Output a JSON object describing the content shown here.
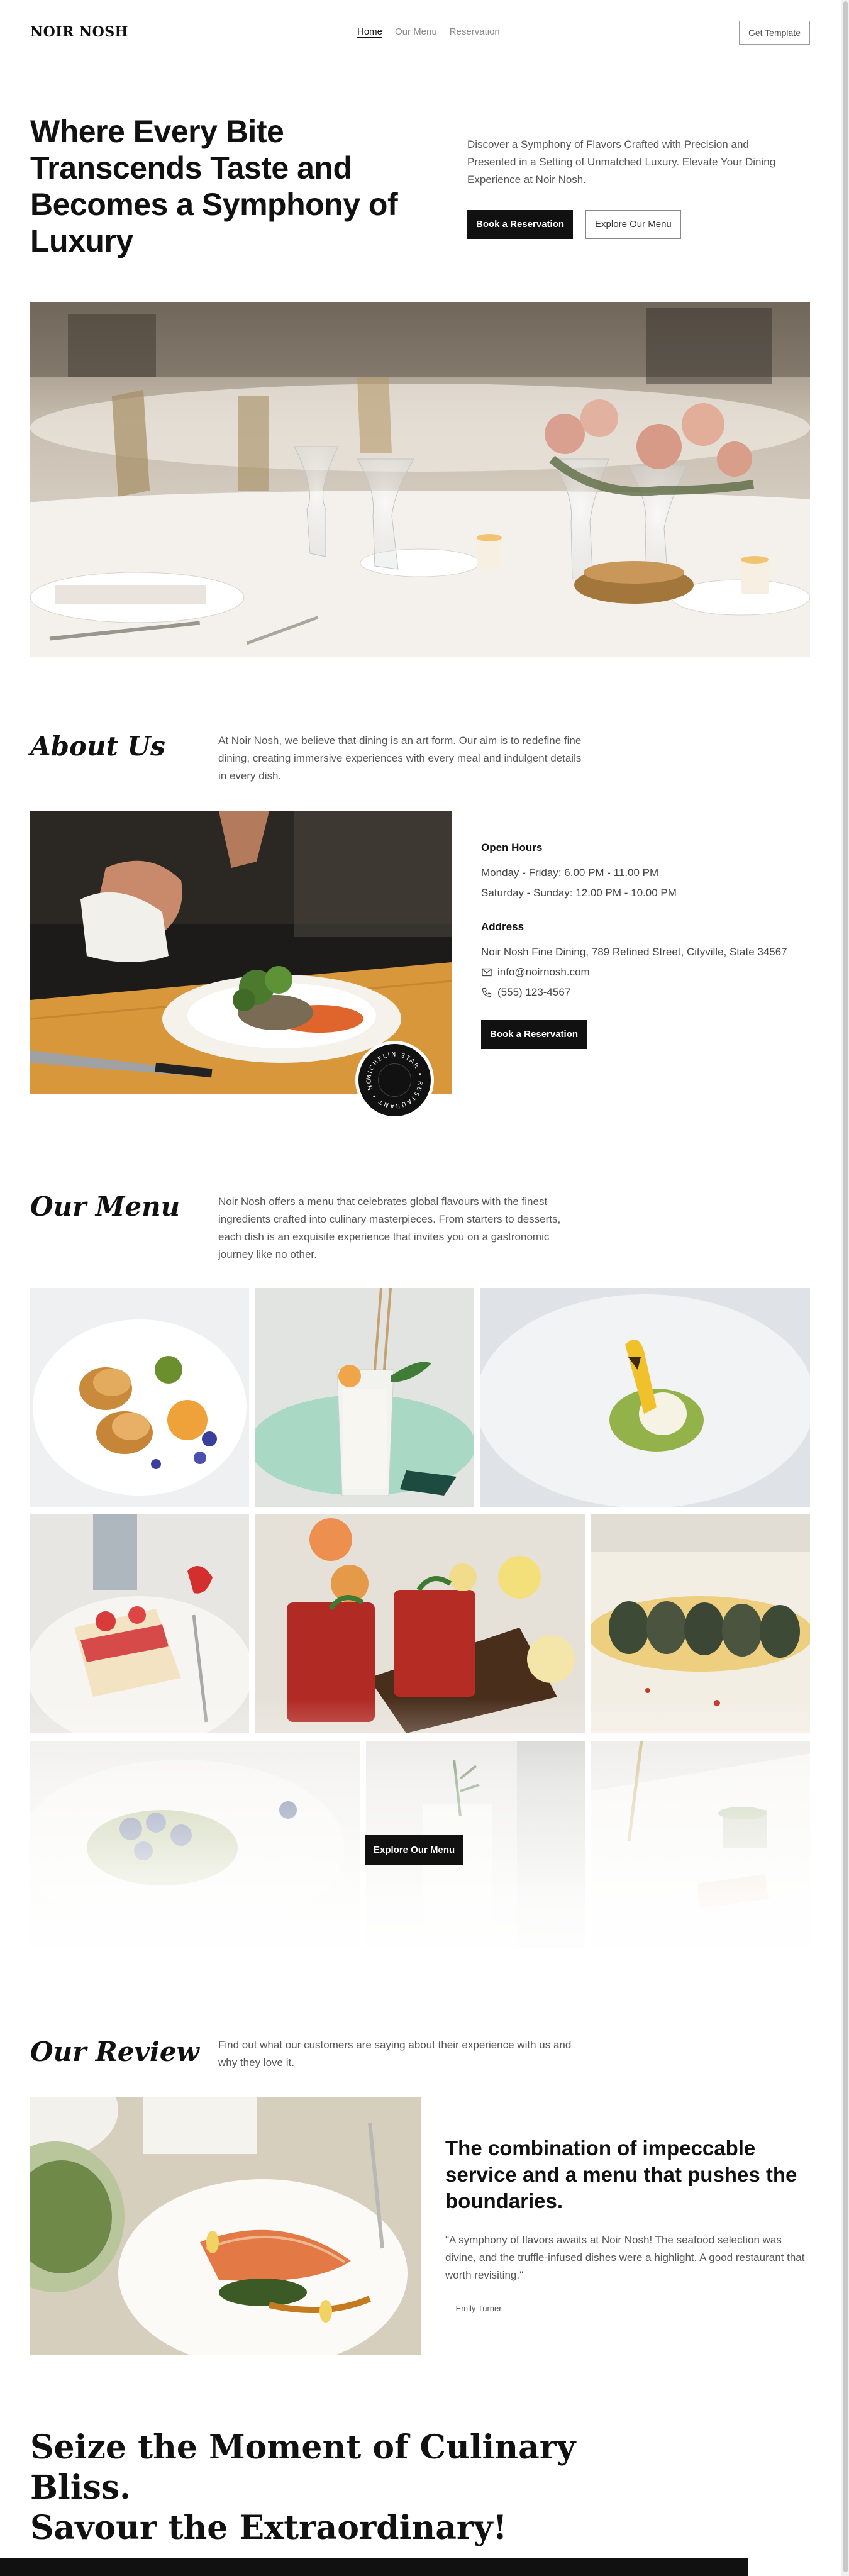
{
  "nav": {
    "logo": "NOIR NOSH",
    "links": [
      "Home",
      "Our Menu",
      "Reservation"
    ],
    "cta": "Get Template"
  },
  "hero": {
    "title": "Where Every Bite Transcends Taste and Becomes a Symphony of Luxury",
    "description": "Discover a Symphony of Flavors Crafted with Precision and Presented in a Setting of Unmatched Luxury. Elevate Your Dining Experience at Noir Nosh.",
    "primary_button": "Book a Reservation",
    "secondary_button": "Explore Our Menu"
  },
  "about": {
    "title": "About Us",
    "description": "At Noir Nosh, we believe that dining is an art form. Our aim is to redefine fine dining, creating immersive experiences with every meal and indulgent details in every dish.",
    "badge_text": "MICHELIN STAR • RESTAURANT • NOIR NOSH •",
    "hours_title": "Open Hours",
    "hours": [
      "Monday - Friday: 6.00 PM - 11.00 PM",
      "Saturday - Sunday: 12.00 PM - 10.00 PM"
    ],
    "address_title": "Address",
    "address": "Noir Nosh Fine Dining, 789 Refined Street, Cityville, State 34567",
    "email": "info@noirnosh.com",
    "phone": "(555) 123-4567",
    "button": "Book a Reservation"
  },
  "menu": {
    "title": "Our Menu",
    "description": "Noir Nosh offers a menu that celebrates global flavours with the finest ingredients crafted into culinary masterpieces. From starters to desserts, each dish is an exquisite experience that invites you on a gastronomic journey like no other.",
    "button": "Explore Our Menu"
  },
  "review": {
    "title": "Our Review",
    "description": "Find out what our customers are saying about their experience with us and why they love it.",
    "headline": "The combination of impeccable service and a menu that pushes the boundaries.",
    "quote": "\"A symphony of flavors awaits at Noir Nosh! The seafood selection was divine, and the truffle-infused dishes were a highlight. A good restaurant that worth revisiting.\"",
    "author": "— Emily Turner"
  },
  "cta": {
    "line1": "Seize the Moment of Culinary Bliss.",
    "line2": "Savour the Extraordinary!"
  },
  "colors": {
    "primary": "#111111",
    "muted_text": "#555555",
    "background": "#ffffff"
  }
}
